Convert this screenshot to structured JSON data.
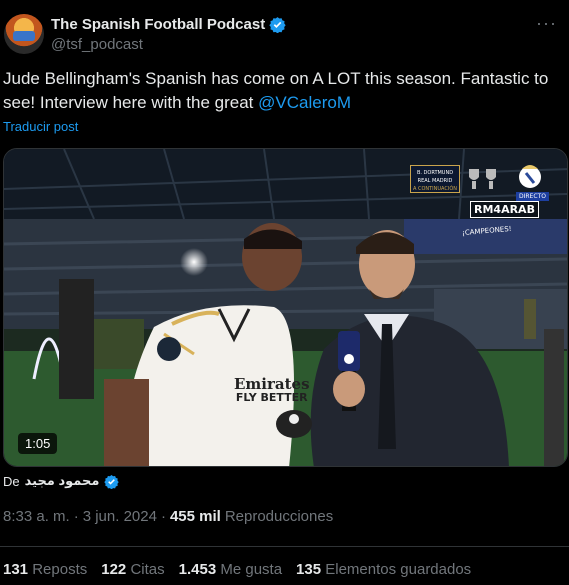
{
  "header": {
    "display_name": "The Spanish Football Podcast",
    "handle": "@tsf_podcast",
    "more_label": "···"
  },
  "tweet": {
    "text_part1": "Jude Bellingham's Spanish has come on A LOT this season. Fantastic to see! Interview here with the great ",
    "mention": "@VCaleroM",
    "translate_label": "Traducir post"
  },
  "media": {
    "duration": "1:05",
    "overlay": {
      "schedule_line1": "B. DORTMUND",
      "schedule_line2": "REAL MADRID",
      "schedule_line3": "A CONTINUACIÓN",
      "live_label": "DIRECTO",
      "watermark": "RM4ARAB",
      "banner": "¡CAMPEONES!",
      "jersey_sponsor_line1": "Emirates",
      "jersey_sponsor_line2": "FLY BETTER"
    }
  },
  "via": {
    "label": "De",
    "name": "محمود مجيد"
  },
  "meta": {
    "time": "8:33 a. m.",
    "separator": "·",
    "date": "3 jun. 2024",
    "separator2": "·",
    "views": "455 mil",
    "views_label": "Reproducciones"
  },
  "stats": {
    "reposts": "131",
    "reposts_label": "Reposts",
    "quotes": "122",
    "quotes_label": "Citas",
    "likes": "1.453",
    "likes_label": "Me gusta",
    "bookmarks": "135",
    "bookmarks_label": "Elementos guardados"
  },
  "colors": {
    "accent": "#1d9bf0",
    "background": "#000000",
    "text_primary": "#e7e9ea",
    "text_secondary": "#71767b"
  }
}
